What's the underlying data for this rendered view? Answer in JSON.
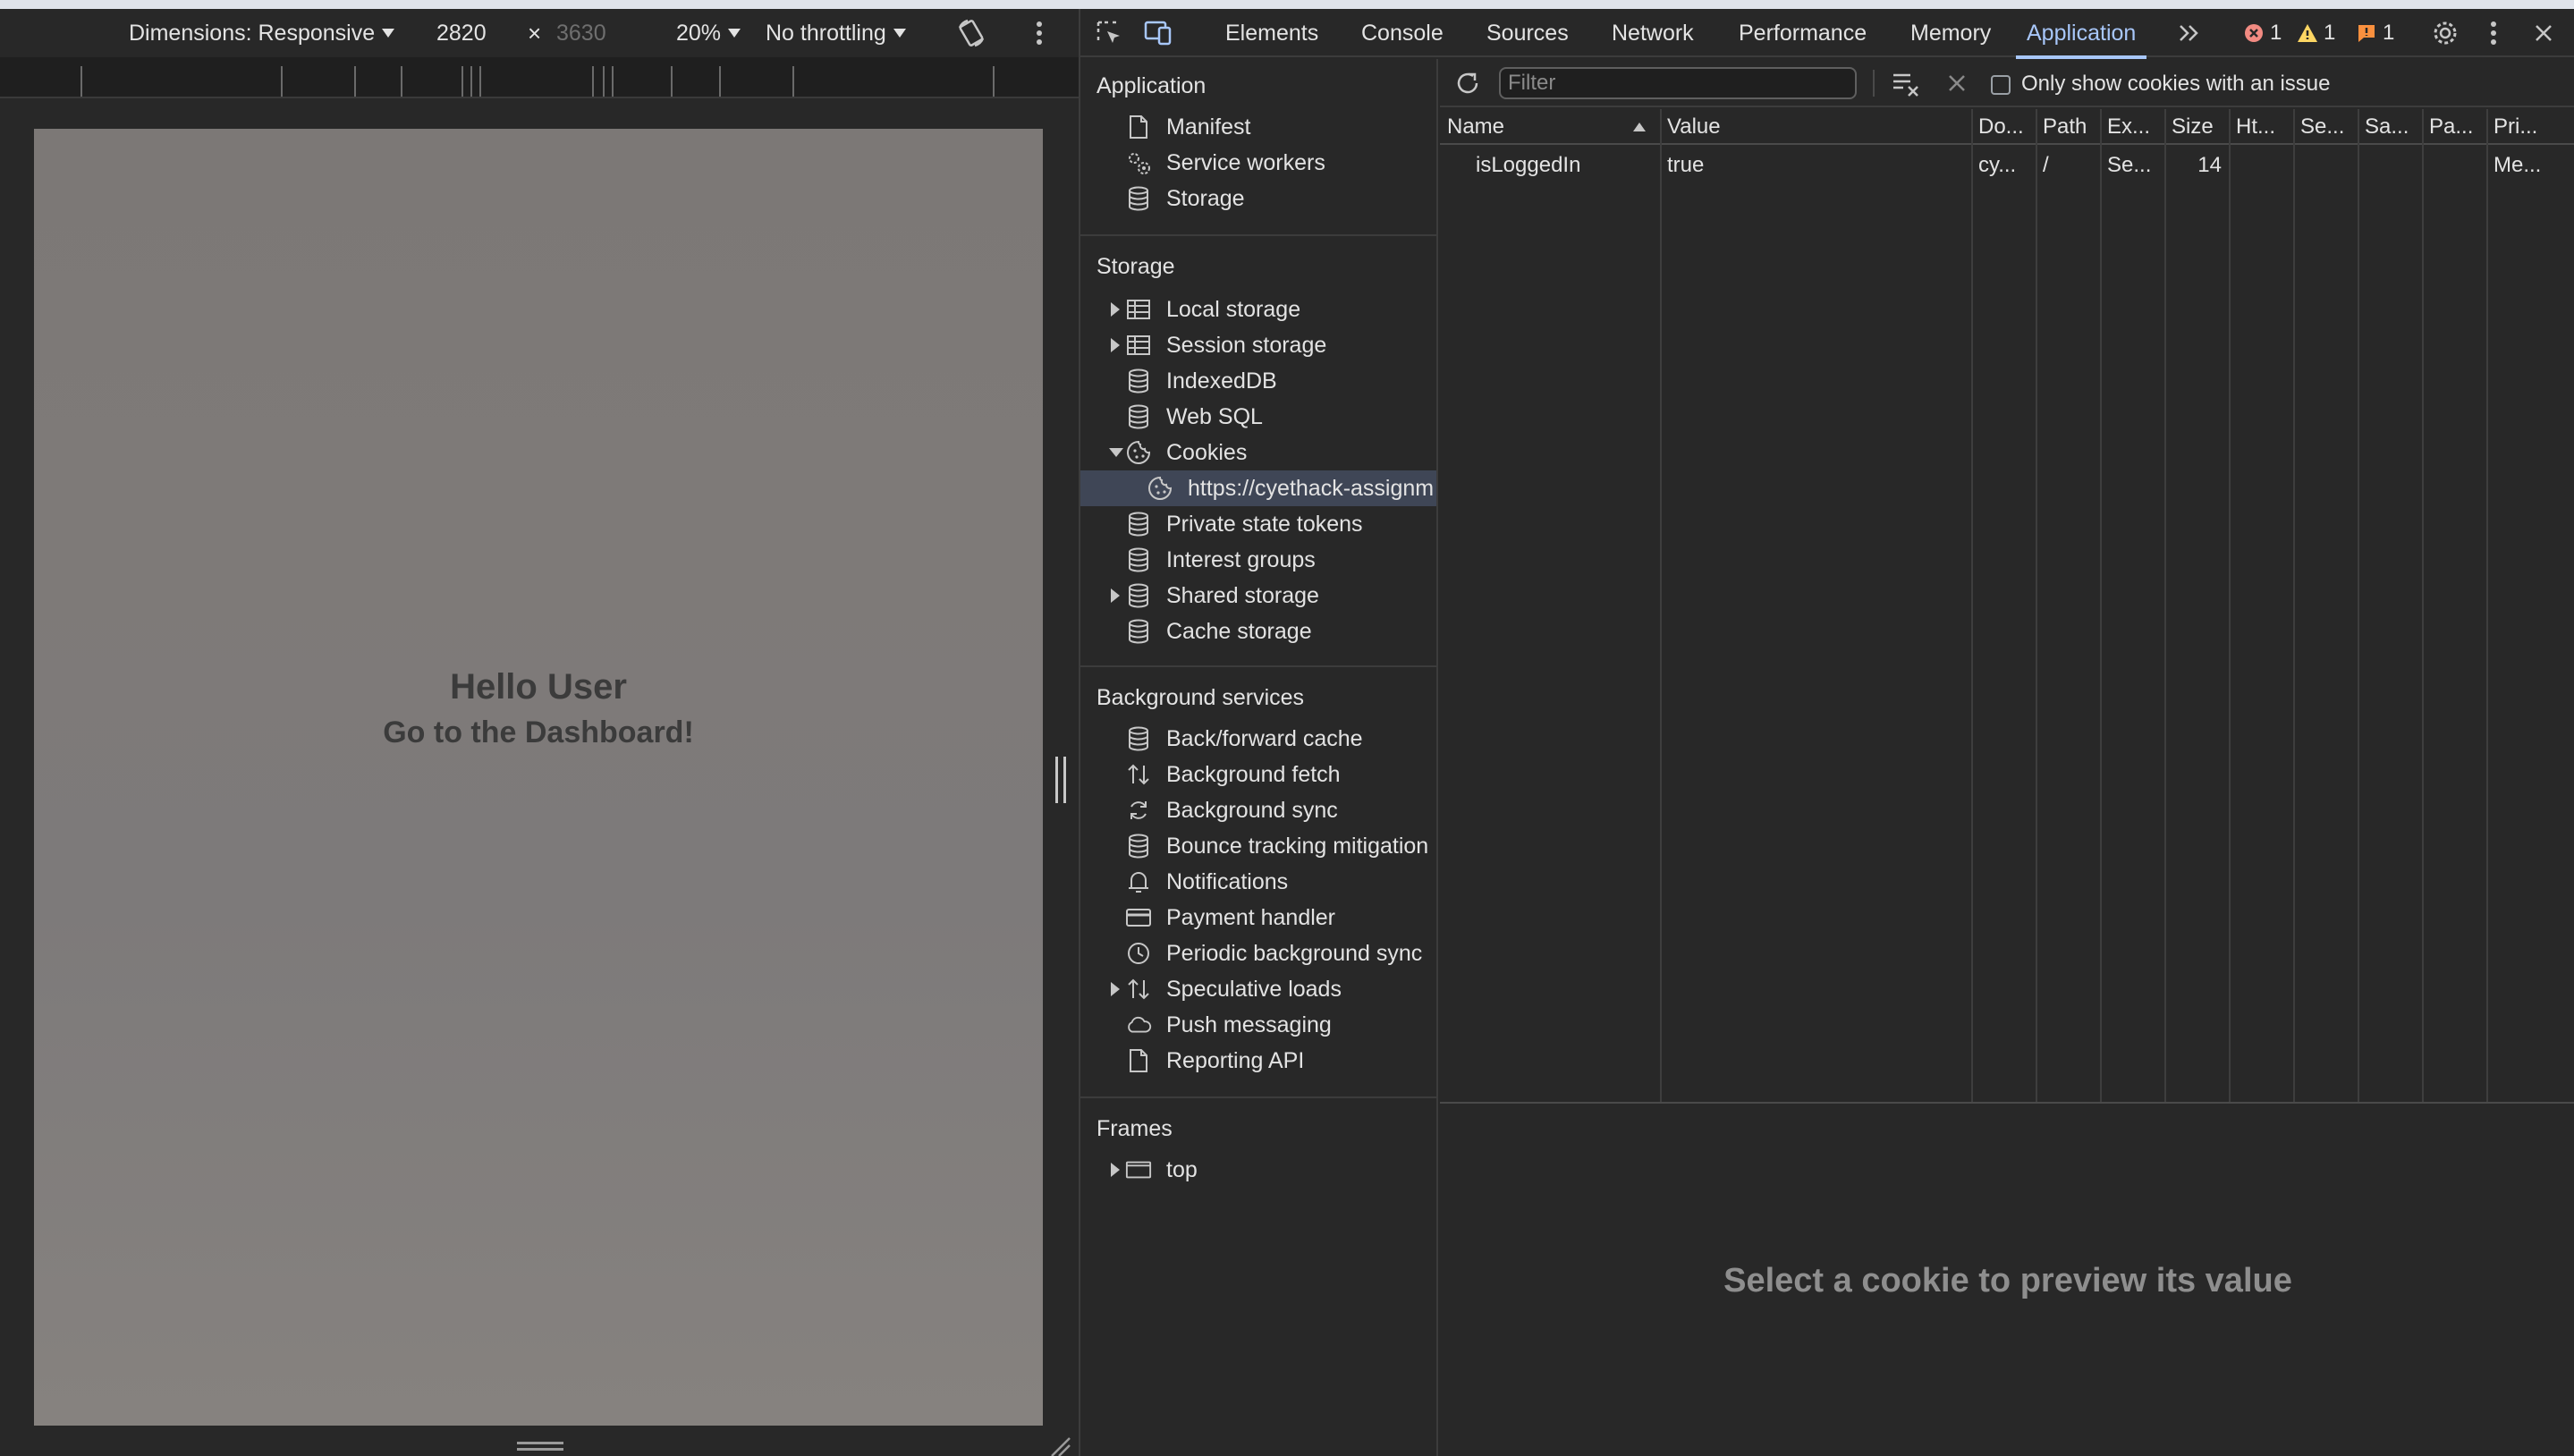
{
  "device_toolbar": {
    "dimensions_label": "Dimensions: Responsive",
    "width_value": "2820",
    "times_symbol": "×",
    "height_value": "3630",
    "zoom_label": "20%",
    "throttling_label": "No throttling"
  },
  "viewport_page": {
    "title": "Hello User",
    "subtitle": "Go to the Dashboard!"
  },
  "devtools_tabs": {
    "items": [
      "Elements",
      "Console",
      "Sources",
      "Network",
      "Performance",
      "Memory",
      "Application"
    ],
    "active": "Application",
    "error_count": "1",
    "warning_count": "1",
    "issue_count": "1"
  },
  "sidebar": {
    "application": {
      "title": "Application",
      "items": [
        "Manifest",
        "Service workers",
        "Storage"
      ]
    },
    "storage": {
      "title": "Storage",
      "items": [
        "Local storage",
        "Session storage",
        "IndexedDB",
        "Web SQL",
        "Cookies",
        "https://cyethack-assignm",
        "Private state tokens",
        "Interest groups",
        "Shared storage",
        "Cache storage"
      ]
    },
    "background_services": {
      "title": "Background services",
      "items": [
        "Back/forward cache",
        "Background fetch",
        "Background sync",
        "Bounce tracking mitigation",
        "Notifications",
        "Payment handler",
        "Periodic background sync",
        "Speculative loads",
        "Push messaging",
        "Reporting API"
      ]
    },
    "frames": {
      "title": "Frames",
      "items": [
        "top"
      ]
    }
  },
  "cookies_panel": {
    "filter_placeholder": "Filter",
    "only_issues_label": "Only show cookies with an issue",
    "columns": [
      "Name",
      "Value",
      "Do...",
      "Path",
      "Ex...",
      "Size",
      "Ht...",
      "Se...",
      "Sa...",
      "Pa...",
      "Pri..."
    ],
    "rows": [
      [
        "isLoggedIn",
        "true",
        "cy...",
        "/",
        "Se...",
        "14",
        "",
        "",
        "",
        "",
        "Me..."
      ]
    ],
    "preview_placeholder": "Select a cookie to preview its value"
  },
  "colors": {
    "accent": "#a8c7fa",
    "error": "#f28b82",
    "warning": "#fdd663",
    "issue": "#fa903e",
    "selected_row": "#3f4656"
  }
}
